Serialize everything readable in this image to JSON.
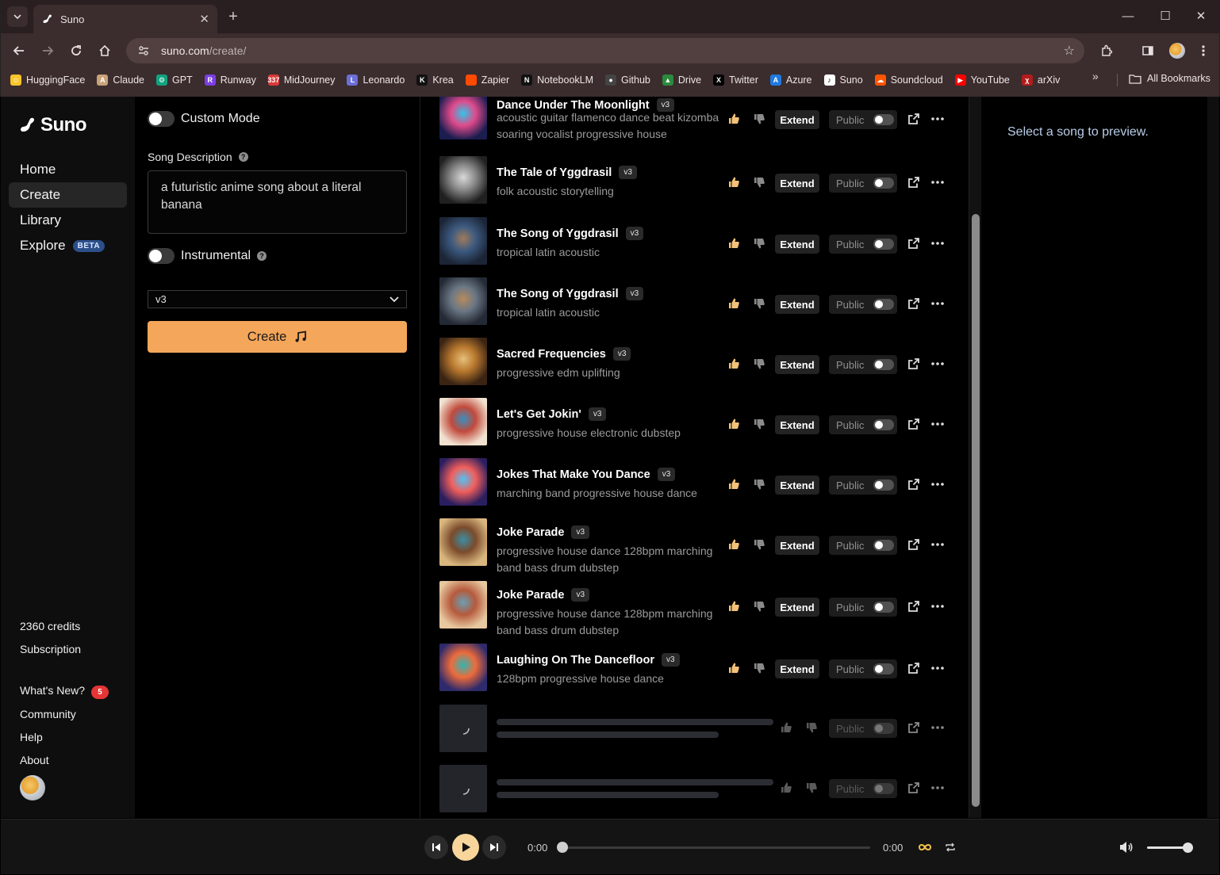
{
  "browser": {
    "tab_title": "Suno",
    "url_host": "suno.com",
    "url_path": "/create/",
    "bookmarks": [
      {
        "label": "HuggingFace",
        "color": "#f7c52b",
        "glyph": "☺"
      },
      {
        "label": "Claude",
        "color": "#c9a27a",
        "glyph": "A"
      },
      {
        "label": "GPT",
        "color": "#10a37f",
        "glyph": "⚙"
      },
      {
        "label": "Runway",
        "color": "#7b3fe4",
        "glyph": "R"
      },
      {
        "label": "MidJourney",
        "color": "#d83a3a",
        "glyph": "337"
      },
      {
        "label": "Leonardo",
        "color": "#6b6fd8",
        "glyph": "L"
      },
      {
        "label": "Krea",
        "color": "#111111",
        "glyph": "K"
      },
      {
        "label": "Zapier",
        "color": "#ff4a00",
        "glyph": ""
      },
      {
        "label": "NotebookLM",
        "color": "#111111",
        "glyph": "N"
      },
      {
        "label": "Github",
        "color": "#444444",
        "glyph": "●"
      },
      {
        "label": "Drive",
        "color": "#2b8a3e",
        "glyph": "▲"
      },
      {
        "label": "Twitter",
        "color": "#000000",
        "glyph": "X"
      },
      {
        "label": "Azure",
        "color": "#1f7ae0",
        "glyph": "A"
      },
      {
        "label": "Suno",
        "color": "#ffffff",
        "glyph": "♪"
      },
      {
        "label": "Soundcloud",
        "color": "#ff5500",
        "glyph": "☁"
      },
      {
        "label": "YouTube",
        "color": "#ff0000",
        "glyph": "▶"
      },
      {
        "label": "arXiv",
        "color": "#b31b1b",
        "glyph": "χ"
      }
    ],
    "all_bookmarks": "All Bookmarks"
  },
  "sidebar": {
    "logo": "Suno",
    "nav": [
      {
        "label": "Home"
      },
      {
        "label": "Create"
      },
      {
        "label": "Library"
      },
      {
        "label": "Explore",
        "badge": "BETA"
      }
    ],
    "credits": "2360 credits",
    "subscription": "Subscription",
    "whats_new": "What's New?",
    "whats_new_count": "5",
    "community": "Community",
    "help": "Help",
    "about": "About"
  },
  "form": {
    "custom_mode": "Custom Mode",
    "song_description_label": "Song Description",
    "song_description_value": "a futuristic anime song about a literal banana",
    "instrumental": "Instrumental",
    "model_version": "v3",
    "create_label": "Create"
  },
  "songs": [
    {
      "title": "Dance Under The Moonlight",
      "version": "v3",
      "tags": "acoustic guitar flamenco dance beat kizomba soaring vocalist progressive house"
    },
    {
      "title": "The Tale of Yggdrasil",
      "version": "v3",
      "tags": "folk acoustic storytelling"
    },
    {
      "title": "The Song of Yggdrasil",
      "version": "v3",
      "tags": "tropical latin acoustic"
    },
    {
      "title": "The Song of Yggdrasil",
      "version": "v3",
      "tags": "tropical latin acoustic"
    },
    {
      "title": "Sacred Frequencies",
      "version": "v3",
      "tags": "progressive edm uplifting"
    },
    {
      "title": "Let's Get Jokin'",
      "version": "v3",
      "tags": "progressive house electronic dubstep"
    },
    {
      "title": "Jokes That Make You Dance",
      "version": "v3",
      "tags": "marching band progressive house dance"
    },
    {
      "title": "Joke Parade",
      "version": "v3",
      "tags": "progressive house dance 128bpm marching band bass drum dubstep"
    },
    {
      "title": "Joke Parade",
      "version": "v3",
      "tags": "progressive house dance 128bpm marching band bass drum dubstep"
    },
    {
      "title": "Laughing On The Dancefloor",
      "version": "v3",
      "tags": "128bpm progressive house dance"
    }
  ],
  "song_actions": {
    "extend": "Extend",
    "public": "Public"
  },
  "preview": {
    "empty_text": "Select a song to preview."
  },
  "player": {
    "current_time": "0:00",
    "duration": "0:00",
    "progress": 0,
    "volume": 0.9
  },
  "colors": {
    "accent": "#f4a65a",
    "beta_badge": "#2c4f8a",
    "notification_badge": "#e53535"
  }
}
